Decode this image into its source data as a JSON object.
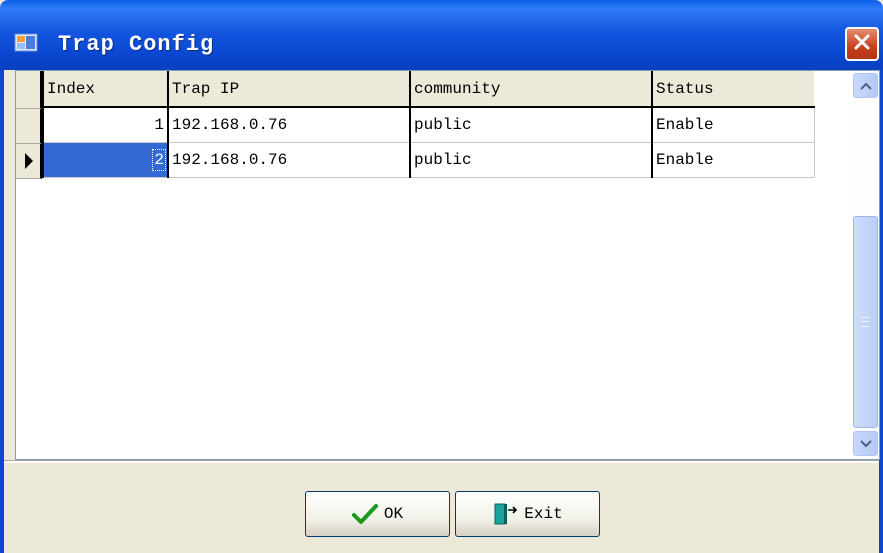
{
  "window": {
    "title": "Trap Config",
    "icon": "app-window-icon",
    "close_icon": "close-icon"
  },
  "grid": {
    "columns": [
      "Index",
      "Trap IP",
      "community",
      "Status"
    ],
    "rows": [
      {
        "index": "1",
        "trap_ip": "192.168.0.76",
        "community": "public",
        "status": "Enable"
      },
      {
        "index": "2",
        "trap_ip": "192.168.0.76",
        "community": "public",
        "status": "Enable"
      }
    ],
    "selected_row": 2
  },
  "buttons": {
    "ok_label": "OK",
    "exit_label": "Exit"
  },
  "colors": {
    "titlebar": "#0a46cf",
    "selection": "#3469d4",
    "close": "#c7411f"
  }
}
